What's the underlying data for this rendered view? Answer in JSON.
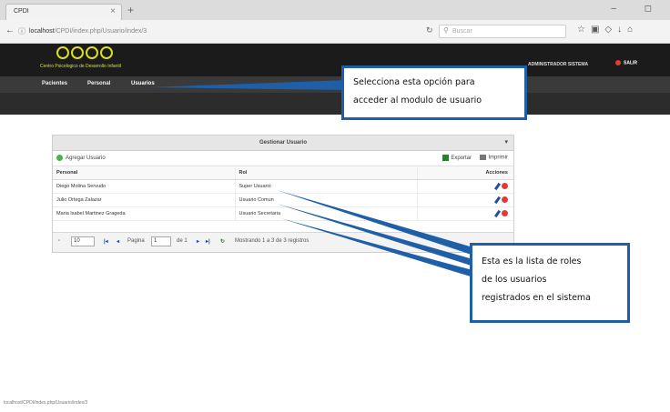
{
  "browser": {
    "tab_title": "CPDI",
    "tab_close": "×",
    "new_tab": "+",
    "window_controls": "–  ◻",
    "url_host": "localhost",
    "url_path": "/CPDI/index.php/Usuario/index/3",
    "search_placeholder": "Buscar",
    "icons": [
      "star-icon",
      "bookmark-icon",
      "pocket-icon",
      "download-icon",
      "home-icon"
    ]
  },
  "app": {
    "logo_text": "Centro Psicologico de Desarrollo Infantil",
    "user_role": "ADMINISTRADOR SISTEMA",
    "logout_label": "SALIR",
    "menu": [
      {
        "label": "Pacientes"
      },
      {
        "label": "Personal"
      },
      {
        "label": "Usuarios"
      }
    ]
  },
  "panel": {
    "title": "Gestionar Usuario",
    "collapse": "▾",
    "add_label": "Agregar Usuario",
    "export_label": "Exportar",
    "print_label": "Imprimir",
    "columns": {
      "personal": "Personal",
      "rol": "Rol",
      "acciones": "Acciones"
    },
    "rows": [
      {
        "personal": "Diego Molina Servudo",
        "rol": "Super Usuario"
      },
      {
        "personal": "Julio Ortega Zalazar",
        "rol": "Usuario Comun"
      },
      {
        "personal": "Maria Isabel Martinez Grageda",
        "rol": "Usuario Secretaria"
      }
    ],
    "pager": {
      "page_size": "10",
      "first": "|◂",
      "prev": "◂",
      "page_label": "Pagina",
      "page_value": "1",
      "of_label": "de 1",
      "next": "▸",
      "last": "▸|",
      "refresh": "↻",
      "summary": "Mostrando 1 a 3 de 3 registros"
    }
  },
  "callouts": {
    "menu_line1": "Selecciona esta opción para",
    "menu_line2": "acceder al modulo de usuario",
    "roles_line1": "Esta es la lista de roles",
    "roles_line2": "de los usuarios",
    "roles_line3": "registrados en el sistema"
  },
  "status_bar": "localhost/CPDI/index.php/Usuario/index/3",
  "colors": {
    "callout_border": "#1f5fa8",
    "header_bg": "#1b1b1b",
    "logo_accent": "#d9e021"
  }
}
